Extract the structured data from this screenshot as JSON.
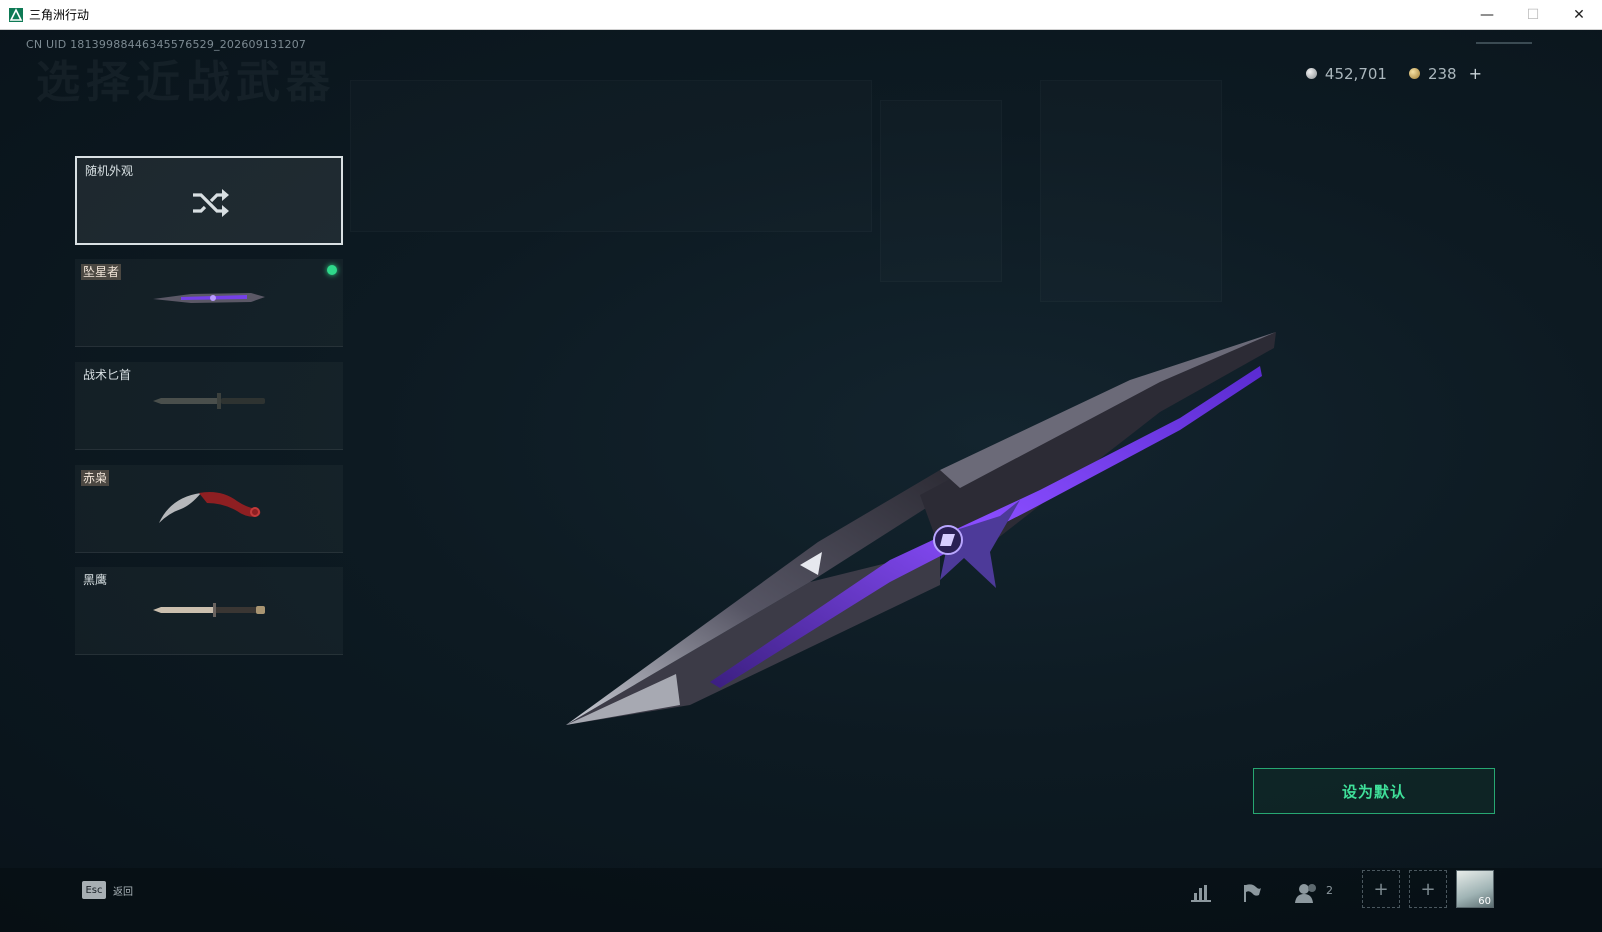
{
  "window": {
    "title": "三角洲行动",
    "controls": {
      "minimize": "—",
      "maximize": "☐",
      "close": "✕"
    }
  },
  "game": {
    "uid_text": "CN UID 1813998844634557652​9_202609131207",
    "page_heading": "选择近战武器",
    "currency": {
      "coins": "452,701",
      "premium": "238",
      "add": "+"
    },
    "weapons": [
      {
        "label": "随机外观",
        "tag": false,
        "selected": true,
        "icon": "shuffle-icon"
      },
      {
        "label": "坠星者",
        "tag": true,
        "selected": false,
        "equipped": true
      },
      {
        "label": "战术匕首",
        "tag": false,
        "selected": false
      },
      {
        "label": "赤枭",
        "tag": true,
        "selected": false
      },
      {
        "label": "黑鹰",
        "tag": false,
        "selected": false
      }
    ],
    "set_default_label": "设为默认",
    "bottom": {
      "esc_key": "Esc",
      "back_label": "返回",
      "friends_count": "2",
      "avatar_level": "60"
    },
    "colors": {
      "accent_green": "#3fe09a",
      "equipped_dot": "#2fd88a",
      "blade_purple": "#7a3cff"
    }
  }
}
